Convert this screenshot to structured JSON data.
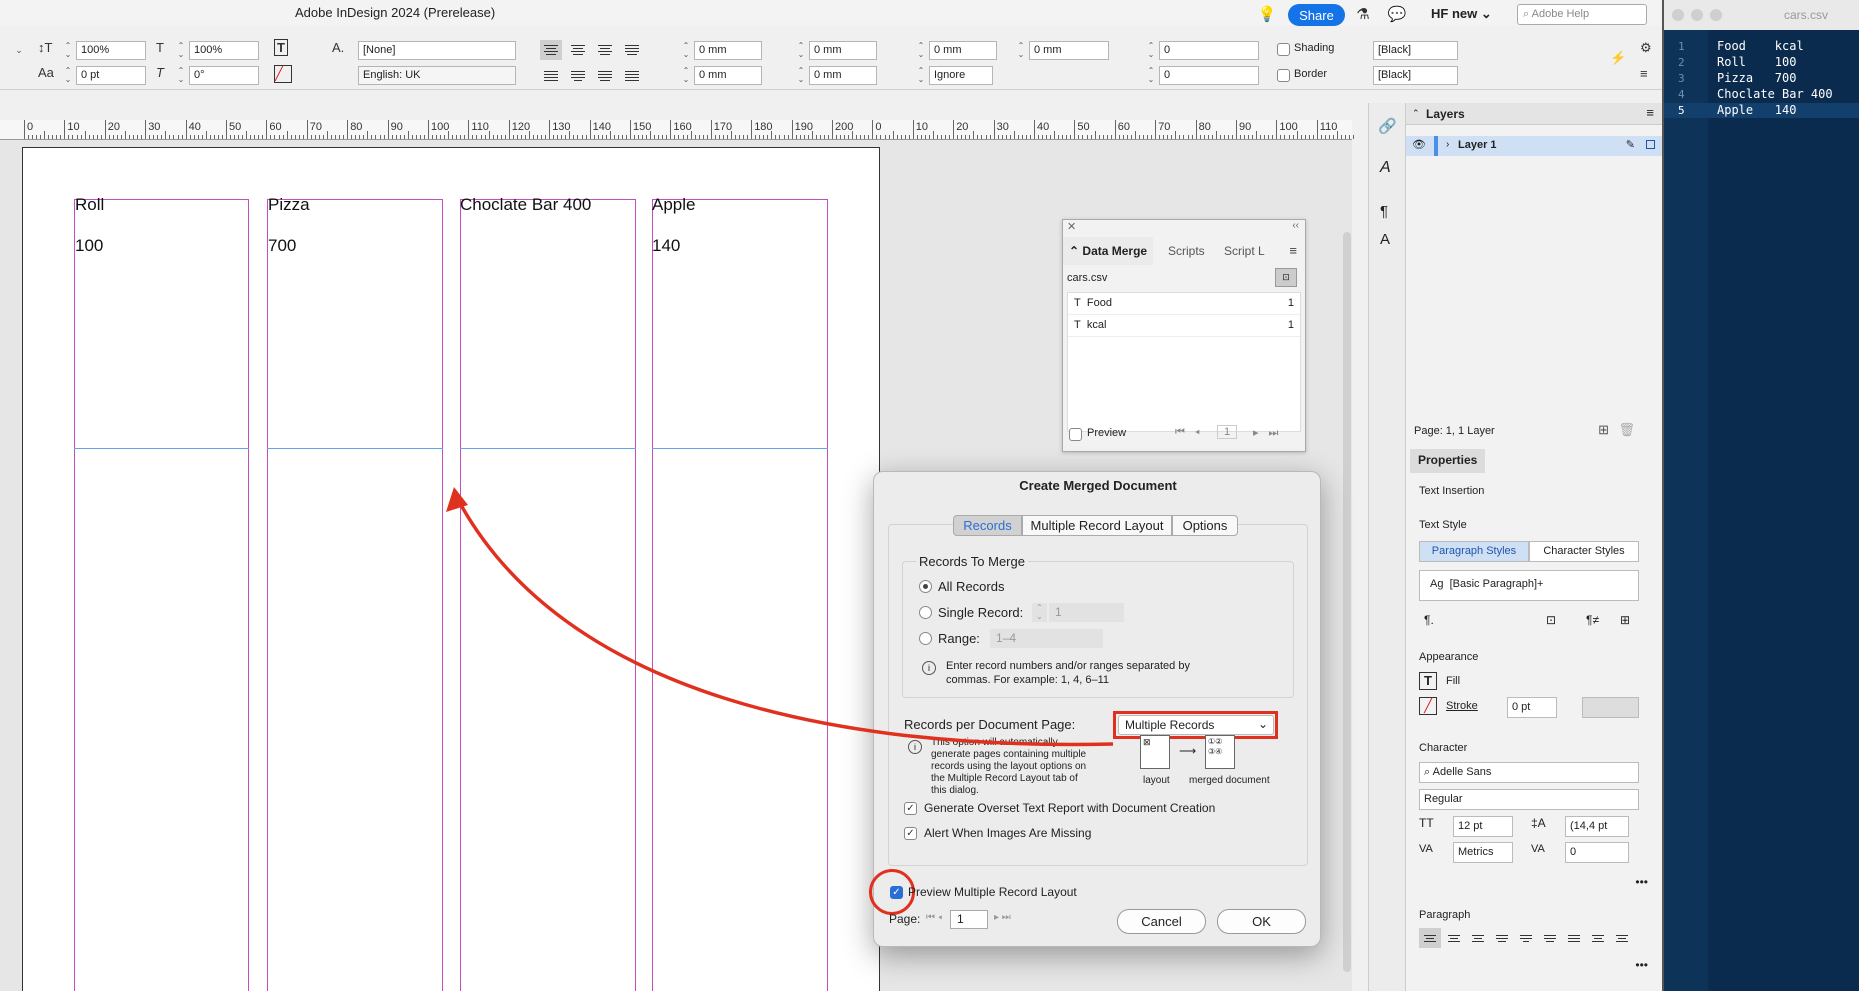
{
  "app": {
    "title": "Adobe InDesign 2024 (Prerelease)",
    "share_label": "Share",
    "workspace": "HF new",
    "help_placeholder": "Adobe Help"
  },
  "control_panel": {
    "vscale": "100%",
    "hscale": "100%",
    "baseline": "0 pt",
    "skew": "0°",
    "char_style": "[None]",
    "language": "English: UK",
    "left_indent": "0 mm",
    "right_indent": "0 mm",
    "space_before": "0 mm",
    "space_after": "0 mm",
    "first_indent": "0 mm",
    "last_indent": "0 mm",
    "baseline_grid": "0 mm",
    "ignore": "Ignore",
    "drop_cap_lines": "0",
    "drop_cap_chars": "0",
    "shading": "Shading",
    "border": "Border",
    "shade_color": "[Black]",
    "border_color": "[Black]"
  },
  "ruler": {
    "labels": [
      "0",
      "10",
      "20",
      "30",
      "40",
      "50",
      "60",
      "70",
      "80",
      "90",
      "100",
      "110",
      "120",
      "130",
      "140",
      "150",
      "160",
      "170",
      "180",
      "190",
      "200",
      "0",
      "10",
      "20",
      "30",
      "40",
      "50",
      "60",
      "70",
      "80",
      "90",
      "100",
      "110"
    ]
  },
  "page_cells": [
    {
      "name": "Roll",
      "value": "100"
    },
    {
      "name": "Pizza",
      "value": "700"
    },
    {
      "name": "Choclate Bar 400",
      "value": ""
    },
    {
      "name": "Apple",
      "value": "140"
    }
  ],
  "data_merge": {
    "tabs": [
      "Data Merge",
      "Scripts",
      "Script L"
    ],
    "source": "cars.csv",
    "fields": [
      {
        "name": "Food",
        "count": "1"
      },
      {
        "name": "kcal",
        "count": "1"
      }
    ],
    "preview_label": "Preview",
    "record": "1"
  },
  "dialog": {
    "title": "Create Merged Document",
    "tabs": [
      "Records",
      "Multiple Record Layout",
      "Options"
    ],
    "group_title": "Records To Merge",
    "all_records": "All Records",
    "single_record": "Single Record:",
    "single_value": "1",
    "range": "Range:",
    "range_value": "1–4",
    "info_text": "Enter record numbers and/or ranges separated by commas. For example: 1, 4, 6–11",
    "records_per_page_label": "Records per Document Page:",
    "records_per_page_value": "Multiple Records",
    "multi_info": "This option will automatically generate pages containing multiple records using the layout options on the Multiple Record Layout tab of this dialog.",
    "layout_label": "layout",
    "merged_label": "merged document",
    "overset_label": "Generate Overset Text Report with Document Creation",
    "alert_label": "Alert When Images Are Missing",
    "preview_label": "Preview Multiple Record Layout",
    "page_label": "Page:",
    "page_value": "1",
    "cancel": "Cancel",
    "ok": "OK",
    "highlight_color": "#e0301e"
  },
  "layers": {
    "title": "Layers",
    "layer": "Layer 1",
    "status": "Page: 1, 1 Layer"
  },
  "properties": {
    "title": "Properties",
    "section": "Text Insertion",
    "text_style": "Text Style",
    "para_tab": "Paragraph Styles",
    "char_tab": "Character Styles",
    "para_style": "[Basic Paragraph]+",
    "appearance": "Appearance",
    "fill": "Fill",
    "stroke": "Stroke",
    "stroke_weight": "0 pt",
    "character": "Character",
    "font": "Adelle Sans",
    "font_style": "Regular",
    "size": "12 pt",
    "leading": "(14,4 pt",
    "kerning": "Metrics",
    "tracking": "0",
    "paragraph": "Paragraph"
  },
  "editor": {
    "title": "cars.csv",
    "lines": [
      {
        "n": "1",
        "text": "Food    kcal"
      },
      {
        "n": "2",
        "text": "Roll    100"
      },
      {
        "n": "3",
        "text": "Pizza   700"
      },
      {
        "n": "4",
        "text": "Choclate Bar 400"
      },
      {
        "n": "5",
        "text": "Apple   140"
      }
    ]
  }
}
